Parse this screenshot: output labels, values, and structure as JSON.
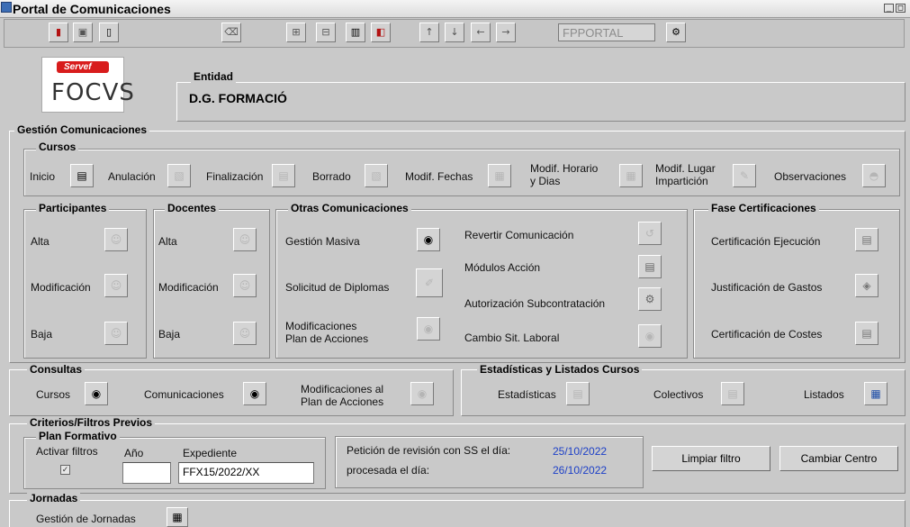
{
  "window": {
    "title": "Portal de Comunicaciones"
  },
  "toolbar": {
    "field_value": "FPPORTAL"
  },
  "entity": {
    "legend": "Entidad",
    "name": "D.G. FORMACIÓ"
  },
  "logo": {
    "top_text": "Servef",
    "main_text": "FOCVS"
  },
  "gestion": {
    "legend": "Gestión Comunicaciones",
    "cursos": {
      "legend": "Cursos",
      "items": [
        "Inicio",
        "Anulación",
        "Finalización",
        "Borrado",
        "Modif. Fechas",
        "Modif. Horario\ny Dias",
        "Modif. Lugar\nImpartición",
        "Observaciones"
      ]
    },
    "participantes": {
      "legend": "Participantes",
      "items": [
        "Alta",
        "Modificación",
        "Baja"
      ]
    },
    "docentes": {
      "legend": "Docentes",
      "items": [
        "Alta",
        "Modificación",
        "Baja"
      ]
    },
    "otras": {
      "legend": "Otras Comunicaciones",
      "left": [
        "Gestión Masiva",
        "Solicitud de Diplomas",
        "Modificaciones\nPlan de Acciones"
      ],
      "right": [
        "Revertir Comunicación",
        "Módulos Acción",
        "Autorización Subcontratación",
        "Cambio Sit. Laboral"
      ]
    },
    "fase": {
      "legend": "Fase Certificaciones",
      "items": [
        "Certificación Ejecución",
        "Justificación de Gastos",
        "Certificación de Costes"
      ]
    }
  },
  "consultas": {
    "legend": "Consultas",
    "items": [
      "Cursos",
      "Comunicaciones",
      "Modificaciones al\nPlan de Acciones"
    ]
  },
  "estadisticas": {
    "legend": "Estadísticas y Listados Cursos",
    "items": [
      "Estadísticas",
      "Colectivos",
      "Listados"
    ]
  },
  "criterios": {
    "legend": "Criterios/Filtros Previos",
    "plan": {
      "legend": "Plan Formativo",
      "activar_label": "Activar filtros",
      "anio_label": "Año",
      "expediente_label": "Expediente",
      "anio_value": "",
      "expediente_value": "FFX15/2022/XX",
      "activar_checked": true
    },
    "peticion_label": "Petición de revisión con SS el día:",
    "peticion_date": "25/10/2022",
    "procesada_label": "procesada el día:",
    "procesada_date": "26/10/2022",
    "limpiar_button": "Limpiar filtro",
    "cambiar_button": "Cambiar Centro"
  },
  "jornadas": {
    "legend": "Jornadas",
    "item": "Gestión de Jornadas"
  }
}
